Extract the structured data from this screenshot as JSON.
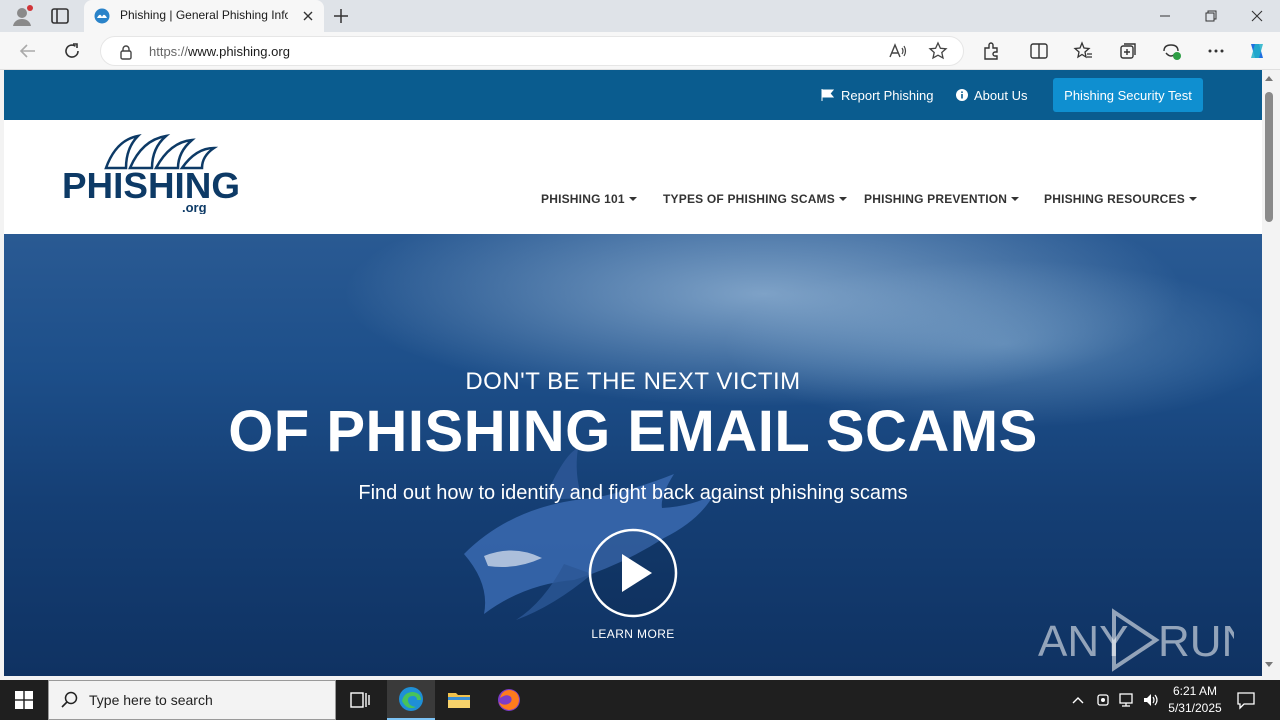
{
  "browser": {
    "tab_title": "Phishing | General Phishing Infor",
    "url_prefix": "https://",
    "url_host": "www.phishing.org"
  },
  "site": {
    "top_links": [
      {
        "label": "Report Phishing",
        "icon": "flag-icon"
      },
      {
        "label": "About Us",
        "icon": "info-icon"
      }
    ],
    "cta_label": "Phishing Security Test",
    "logo_text": "PHISHING",
    "logo_tld": ".org",
    "nav": [
      {
        "label": "PHISHING 101"
      },
      {
        "label": "TYPES OF PHISHING SCAMS"
      },
      {
        "label": "PHISHING PREVENTION"
      },
      {
        "label": "PHISHING RESOURCES"
      }
    ]
  },
  "hero": {
    "kicker": "DON'T BE THE NEXT VICTIM",
    "headline": "OF PHISHING EMAIL SCAMS",
    "subtitle": "Find out how to identify and fight back against phishing scams",
    "cta": "LEARN MORE",
    "watermark": "ANY RUN"
  },
  "taskbar": {
    "search_placeholder": "Type here to search",
    "time": "6:21 AM",
    "date": "5/31/2025"
  },
  "colors": {
    "topbar": "#0a5c8f",
    "cta": "#0f8fd0",
    "logo_navy": "#0d3a66"
  }
}
